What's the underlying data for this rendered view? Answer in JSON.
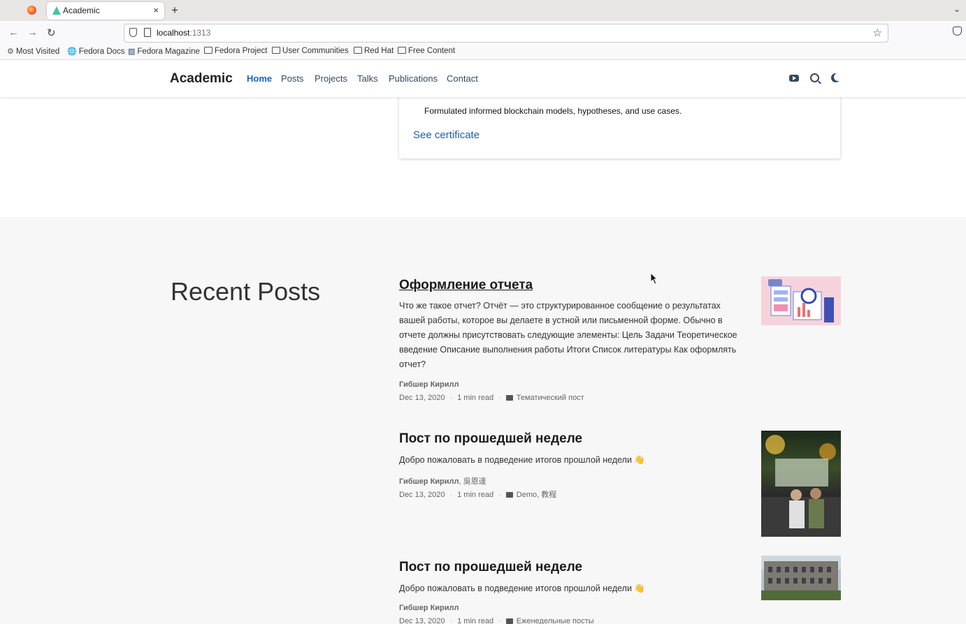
{
  "browser": {
    "tab_title": "Academic",
    "tab_close": "×",
    "new_tab": "+",
    "url_host": "localhost",
    "url_port": ":1313",
    "bookmarks": [
      {
        "label": "Most Visited",
        "icon": "gear-icon"
      },
      {
        "label": "Fedora Docs",
        "icon": "globe-icon"
      },
      {
        "label": "Fedora Magazine",
        "icon": "magazine-icon"
      },
      {
        "label": "Fedora Project",
        "icon": "folder-icon"
      },
      {
        "label": "User Communities",
        "icon": "folder-icon"
      },
      {
        "label": "Red Hat",
        "icon": "folder-icon"
      },
      {
        "label": "Free Content",
        "icon": "folder-icon"
      }
    ]
  },
  "site": {
    "brand": "Academic",
    "menu": [
      "Home",
      "Posts",
      "Projects",
      "Talks",
      "Publications",
      "Contact"
    ],
    "active_menu": "Home",
    "icons": [
      "youtube-icon",
      "search-icon",
      "moon-icon"
    ]
  },
  "certificate": {
    "description": "Formulated informed blockchain models, hypotheses, and use cases.",
    "link": "See certificate"
  },
  "recent_posts": {
    "title": "Recent Posts",
    "posts": [
      {
        "title": "Оформление отчета",
        "summary": "Что же такое отчет? Отчёт — это структурированное сообщение о результатах вашей работы, которое вы делаете в устной или письменной форме. Обычно в отчете должны присутствовать следующие элементы: Цель Задачи Теоретическое введение Описание выполнения работы Итоги Список литературы Как оформлять отчет?",
        "authors": "Гибшер Кирилл",
        "date": "Dec 13, 2020",
        "read_time": "1 min read",
        "category": "Тематический пост"
      },
      {
        "title": "Пост по прошедшей неделе",
        "summary": "Добро пожаловать в подведение итогов прошлой недели 👋",
        "authors_bold": "Гибшер Кирилл",
        "authors_rest": ", 吳恩達",
        "date": "Dec 13, 2020",
        "read_time": "1 min read",
        "category": "Demo, 教程"
      },
      {
        "title": "Пост по прошедшей неделе",
        "summary": "Добро пожаловать в подведение итогов прошлой недели 👋",
        "authors": "Гибшер Кирилл",
        "date": "Dec 13, 2020",
        "read_time": "1 min read",
        "category": "Еженедельные посты"
      }
    ]
  }
}
